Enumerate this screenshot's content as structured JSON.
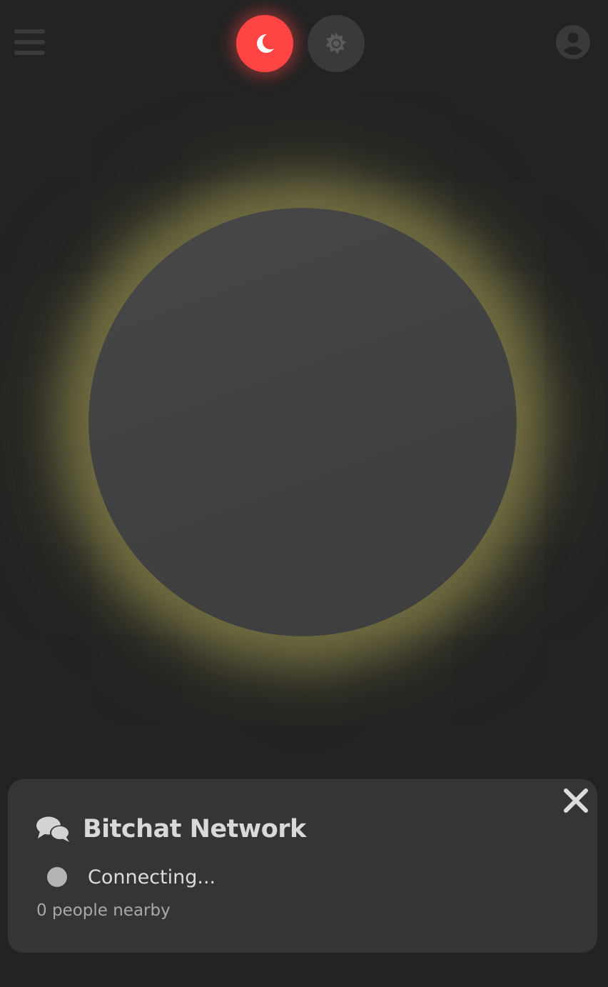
{
  "header": {
    "menu_icon": "hamburger-menu-icon",
    "night_mode_icon": "crescent-moon-icon",
    "day_mode_icon": "sun-icon",
    "profile_icon": "user-avatar-icon",
    "active_mode": "night"
  },
  "orb": {
    "glow_color": "#a09b55",
    "fill_color": "#444444"
  },
  "network_panel": {
    "icon": "chat-bubbles-icon",
    "title": "Bitchat Network",
    "status_text": "Connecting...",
    "status_indicator_color": "#b3b3b3",
    "nearby_text": "0 people nearby",
    "close_icon": "close-icon"
  },
  "colors": {
    "background": "#232323",
    "accent": "#ff4444",
    "panel": "#353535"
  }
}
